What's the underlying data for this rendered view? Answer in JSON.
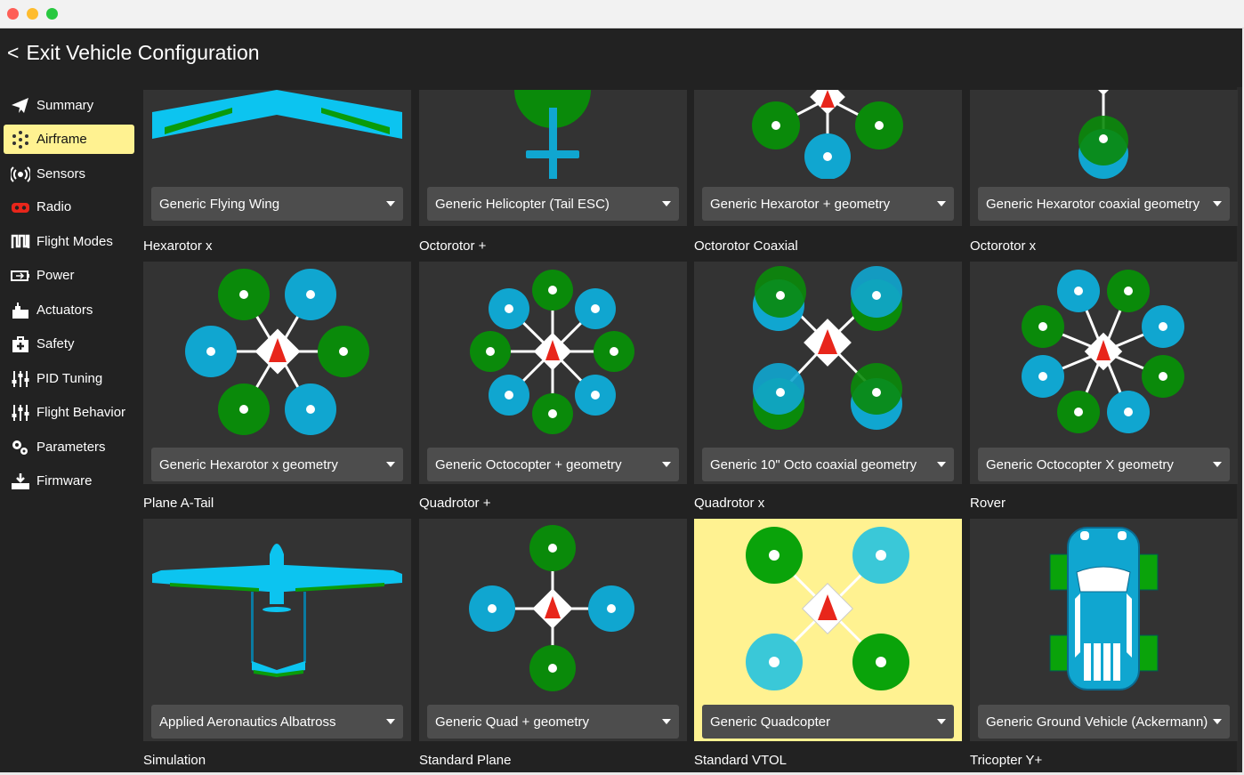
{
  "window": {
    "buttons": [
      "close",
      "minimize",
      "zoom"
    ]
  },
  "header": {
    "back_glyph": "<",
    "title": "Exit Vehicle Configuration"
  },
  "sidebar": {
    "items": [
      {
        "label": "Summary",
        "icon": "paper-plane-icon"
      },
      {
        "label": "Airframe",
        "icon": "airframe-dots-icon",
        "active": true
      },
      {
        "label": "Sensors",
        "icon": "broadcast-icon"
      },
      {
        "label": "Radio",
        "icon": "gamepad-icon"
      },
      {
        "label": "Flight Modes",
        "icon": "flight-modes-icon"
      },
      {
        "label": "Power",
        "icon": "battery-icon"
      },
      {
        "label": "Actuators",
        "icon": "actuator-icon"
      },
      {
        "label": "Safety",
        "icon": "first-aid-icon"
      },
      {
        "label": "PID Tuning",
        "icon": "sliders-icon"
      },
      {
        "label": "Flight Behavior",
        "icon": "sliders-icon"
      },
      {
        "label": "Parameters",
        "icon": "gears-icon"
      },
      {
        "label": "Firmware",
        "icon": "firmware-icon"
      }
    ]
  },
  "groups": [
    {
      "title": "",
      "selected": "Generic Flying Wing",
      "art": "flying-wing"
    },
    {
      "title": "",
      "selected": "Generic Helicopter (Tail ESC)",
      "art": "helicopter"
    },
    {
      "title": "",
      "selected": "Generic Hexarotor + geometry",
      "art": "hexarotor-plus"
    },
    {
      "title": "",
      "selected": "Generic Hexarotor coaxial geometry",
      "art": "hexarotor-coaxial"
    },
    {
      "title": "Hexarotor x",
      "selected": "Generic Hexarotor x geometry",
      "art": "hexarotor-x"
    },
    {
      "title": "Octorotor +",
      "selected": "Generic Octocopter + geometry",
      "art": "octo-plus"
    },
    {
      "title": "Octorotor Coaxial",
      "selected": "Generic 10\" Octo coaxial geometry",
      "art": "octo-coaxial"
    },
    {
      "title": "Octorotor x",
      "selected": "Generic Octocopter X geometry",
      "art": "octo-x"
    },
    {
      "title": "Plane A-Tail",
      "selected": "Applied Aeronautics Albatross",
      "art": "plane"
    },
    {
      "title": "Quadrotor +",
      "selected": "Generic Quad + geometry",
      "art": "quad-plus"
    },
    {
      "title": "Quadrotor x",
      "selected": "Generic Quadcopter",
      "art": "quad-x",
      "current": true
    },
    {
      "title": "Rover",
      "selected": "Generic Ground Vehicle (Ackermann)",
      "art": "rover"
    },
    {
      "title": "Simulation"
    },
    {
      "title": "Standard Plane"
    },
    {
      "title": "Standard VTOL"
    },
    {
      "title": "Tricopter Y+"
    }
  ],
  "colors": {
    "highlight": "#fff291",
    "background": "#222222",
    "tile": "#333333",
    "combo": "#4d4d4d",
    "green_rotor": "#0a8a0a",
    "blue_rotor": "#10a6d0",
    "cyan_rotor": "#3ac8d8",
    "arrow_red": "#e8261b",
    "wing_blue": "#0cc4f0"
  }
}
